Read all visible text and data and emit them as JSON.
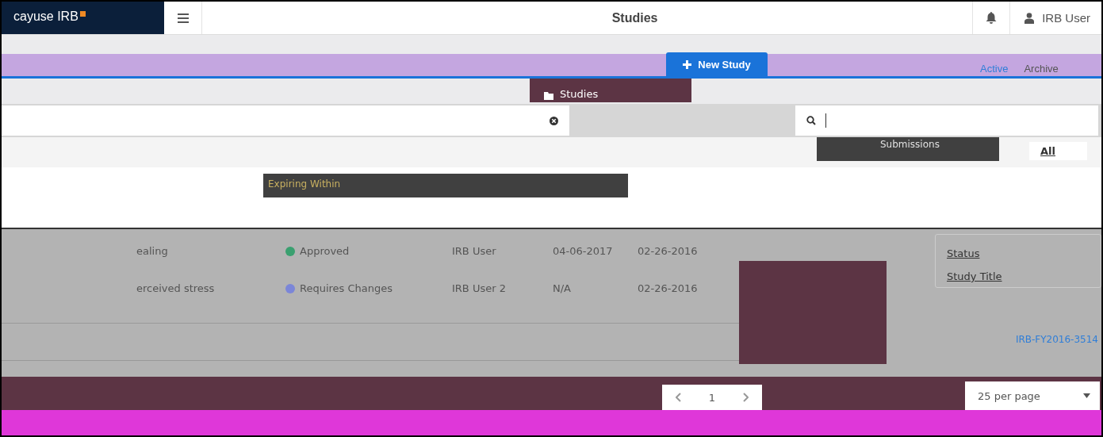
{
  "header": {
    "logo": "cayuse IRB",
    "page_title": "Studies",
    "user": "IRB User"
  },
  "toolbar": {
    "new_button": "New Study",
    "tabs": [
      {
        "label": "Active",
        "selected": true
      },
      {
        "label": "Archive",
        "selected": false
      }
    ]
  },
  "nav": {
    "current": "Studies"
  },
  "filters": {
    "submissions_label": "Submissions",
    "all_link": "All",
    "expiring_label": "Expiring Within"
  },
  "table": {
    "rows": [
      {
        "title": "ealing",
        "status": "Approved",
        "color": "#3aa070",
        "owner": "IRB User",
        "date_1": "04-06-2017",
        "date_2": "02-26-2016"
      },
      {
        "title": "erceived stress",
        "status": "Requires Changes",
        "color": "#7b86d8",
        "owner": "IRB User 2",
        "date_1": "N/A",
        "date_2": "02-26-2016"
      }
    ],
    "study_link": "IRB-FY2016-3514"
  },
  "sort_menu": {
    "items": [
      {
        "label": "Status"
      },
      {
        "label": "Study Title"
      }
    ]
  },
  "pagination": {
    "page": "1",
    "per_page": "25 per page"
  }
}
